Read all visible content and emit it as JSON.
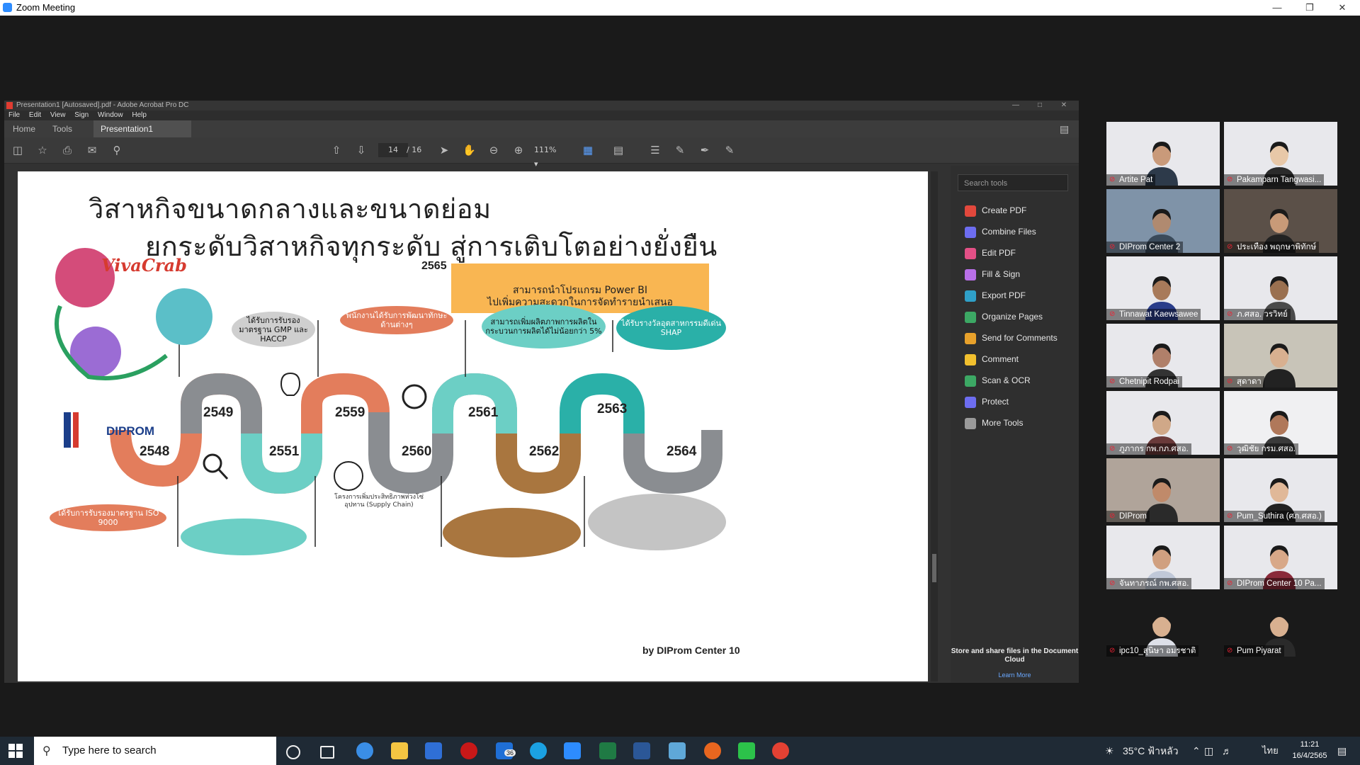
{
  "window": {
    "title": "Zoom Meeting"
  },
  "acrobat": {
    "title": "Presentation1 [Autosaved].pdf - Adobe Acrobat Pro DC",
    "menu": [
      "File",
      "Edit",
      "View",
      "Sign",
      "Window",
      "Help"
    ],
    "tabs": {
      "home": "Home",
      "tools": "Tools",
      "doc": "Presentation1 [Aut..."
    },
    "page_current": "14",
    "page_total": "/ 16",
    "zoom": "111%",
    "search_placeholder": "Search tools",
    "tools": [
      "Create PDF",
      "Combine Files",
      "Edit PDF",
      "Fill & Sign",
      "Export PDF",
      "Organize Pages",
      "Send for Comments",
      "Comment",
      "Scan & OCR",
      "Protect",
      "More Tools"
    ],
    "tool_colors": [
      "#e2483c",
      "#6d6df0",
      "#e35086",
      "#b86fe8",
      "#2fa0c8",
      "#3ca864",
      "#e8a12b",
      "#f2c02e",
      "#3ca864",
      "#6d6df0",
      "#9a9a9a"
    ],
    "cloud_text": "Store and share files in the Document Cloud",
    "learn_more": "Learn More"
  },
  "slide": {
    "title1": "วิสาหกิจขนาดกลางและขนาดย่อม",
    "title2": "ยกระดับวิสาหกิจทุกระดับ สู่การเติบโตอย่างยั่งยืน",
    "years": [
      "2548",
      "2549",
      "2551",
      "2559",
      "2560",
      "2561",
      "2562",
      "2563",
      "2564",
      "2565"
    ],
    "brand_viva": "VivaCrab",
    "brand_dip": "DIPROM",
    "pbi_text_1": "สามารถนำโปรแกรม Power BI",
    "pbi_text_2": "ไปเพิ่มความสะดวกในการจัดทำรายนำเสนอ",
    "pill_gmp": "ได้รับการรับรองมาตรฐาน GMP และ HACCP",
    "pill_iso": "ได้รับการรับรองมาตรฐาน ISO 9000",
    "pill_staff": "พนักงานได้รับการพัฒนาทักษะด้านต่างๆ",
    "pill_prod": "สามารถเพิ่มผลิตภาพการผลิตในกระบวนการผลิตได้ไม่น้อยกว่า 5%",
    "pill_shap": "ได้รับรางวัลอุตสาหกรรมดีเด่น SHAP",
    "small_supply": "โครงการเพิ่มประสิทธิภาพห่วงโซ่อุปทาน (Supply Chain)",
    "byline": "by DIProm Center 10"
  },
  "participants": [
    {
      "name": "Artite Pat",
      "bg": "#e8e8ec",
      "skin": "#c99a7a",
      "shirt": "#2d3a4a"
    },
    {
      "name": "Pakamparn Tangwasi...",
      "bg": "#e8e8ec",
      "skin": "#e8c8a8",
      "shirt": "#2b2b2b"
    },
    {
      "name": "DIProm Center 2",
      "bg": "#7f93a8",
      "skin": "#b08a70",
      "shirt": "#3a4a5a"
    },
    {
      "name": "ประเทือง พฤกษาพิทักษ์",
      "bg": "#5b5048",
      "skin": "#c89a78",
      "shirt": "#222"
    },
    {
      "name": "Tinnawat Kaewsawee",
      "bg": "#e8e8ec",
      "skin": "#a87a5a",
      "shirt": "#2a3d8a"
    },
    {
      "name": "ภ.ศสอ. วรวิทย์",
      "bg": "#e8e8ec",
      "skin": "#9a7050",
      "shirt": "#4a4a4a"
    },
    {
      "name": "Chetnipit Rodpai",
      "bg": "#e8e8ec",
      "skin": "#b0806a",
      "shirt": "#333"
    },
    {
      "name": "สุดาดา",
      "bg": "#c8c4b8",
      "skin": "#d8b090",
      "shirt": "#222"
    },
    {
      "name": "ภูภากร กพ.กภ.ศสอ.",
      "bg": "#e8e8ec",
      "skin": "#d0a888",
      "shirt": "#6a3a3a"
    },
    {
      "name": "วุฒิชัย กรม.ศสอ.",
      "bg": "#f0f0f2",
      "skin": "#b0785a",
      "shirt": "#3a3a3a"
    },
    {
      "name": "DIProm",
      "bg": "#b0a49a",
      "skin": "#c08a6a",
      "shirt": "#2a2a2a"
    },
    {
      "name": "Pum_Suthira (ศภ.ศสอ.)",
      "bg": "#e8e8ec",
      "skin": "#e0b898",
      "shirt": "#222"
    },
    {
      "name": "จันทาภรณ์ กพ.ศสอ.",
      "bg": "#e8e8ec",
      "skin": "#d0a080",
      "shirt": "#c0c8d8"
    },
    {
      "name": "DIProm Center 10 Pa...",
      "bg": "#e8e8ec",
      "skin": "#d8a888",
      "shirt": "#8a2a3a"
    },
    {
      "name": "ipc10_สุนิษา อมรชาติ",
      "bg": "#1a1a1a",
      "skin": "#d8b090",
      "shirt": "#dde0e8"
    },
    {
      "name": "Pum Piyarat",
      "bg": "#1a1a1a",
      "skin": "#d8b090",
      "shirt": "#2a2a2a"
    }
  ],
  "taskbar": {
    "search_placeholder": "Type here to search",
    "weather": "35°C ฟ้าหลัว",
    "lang": "ไทย",
    "time": "11:21",
    "date": "16/4/2565",
    "notify_badge": "36"
  }
}
